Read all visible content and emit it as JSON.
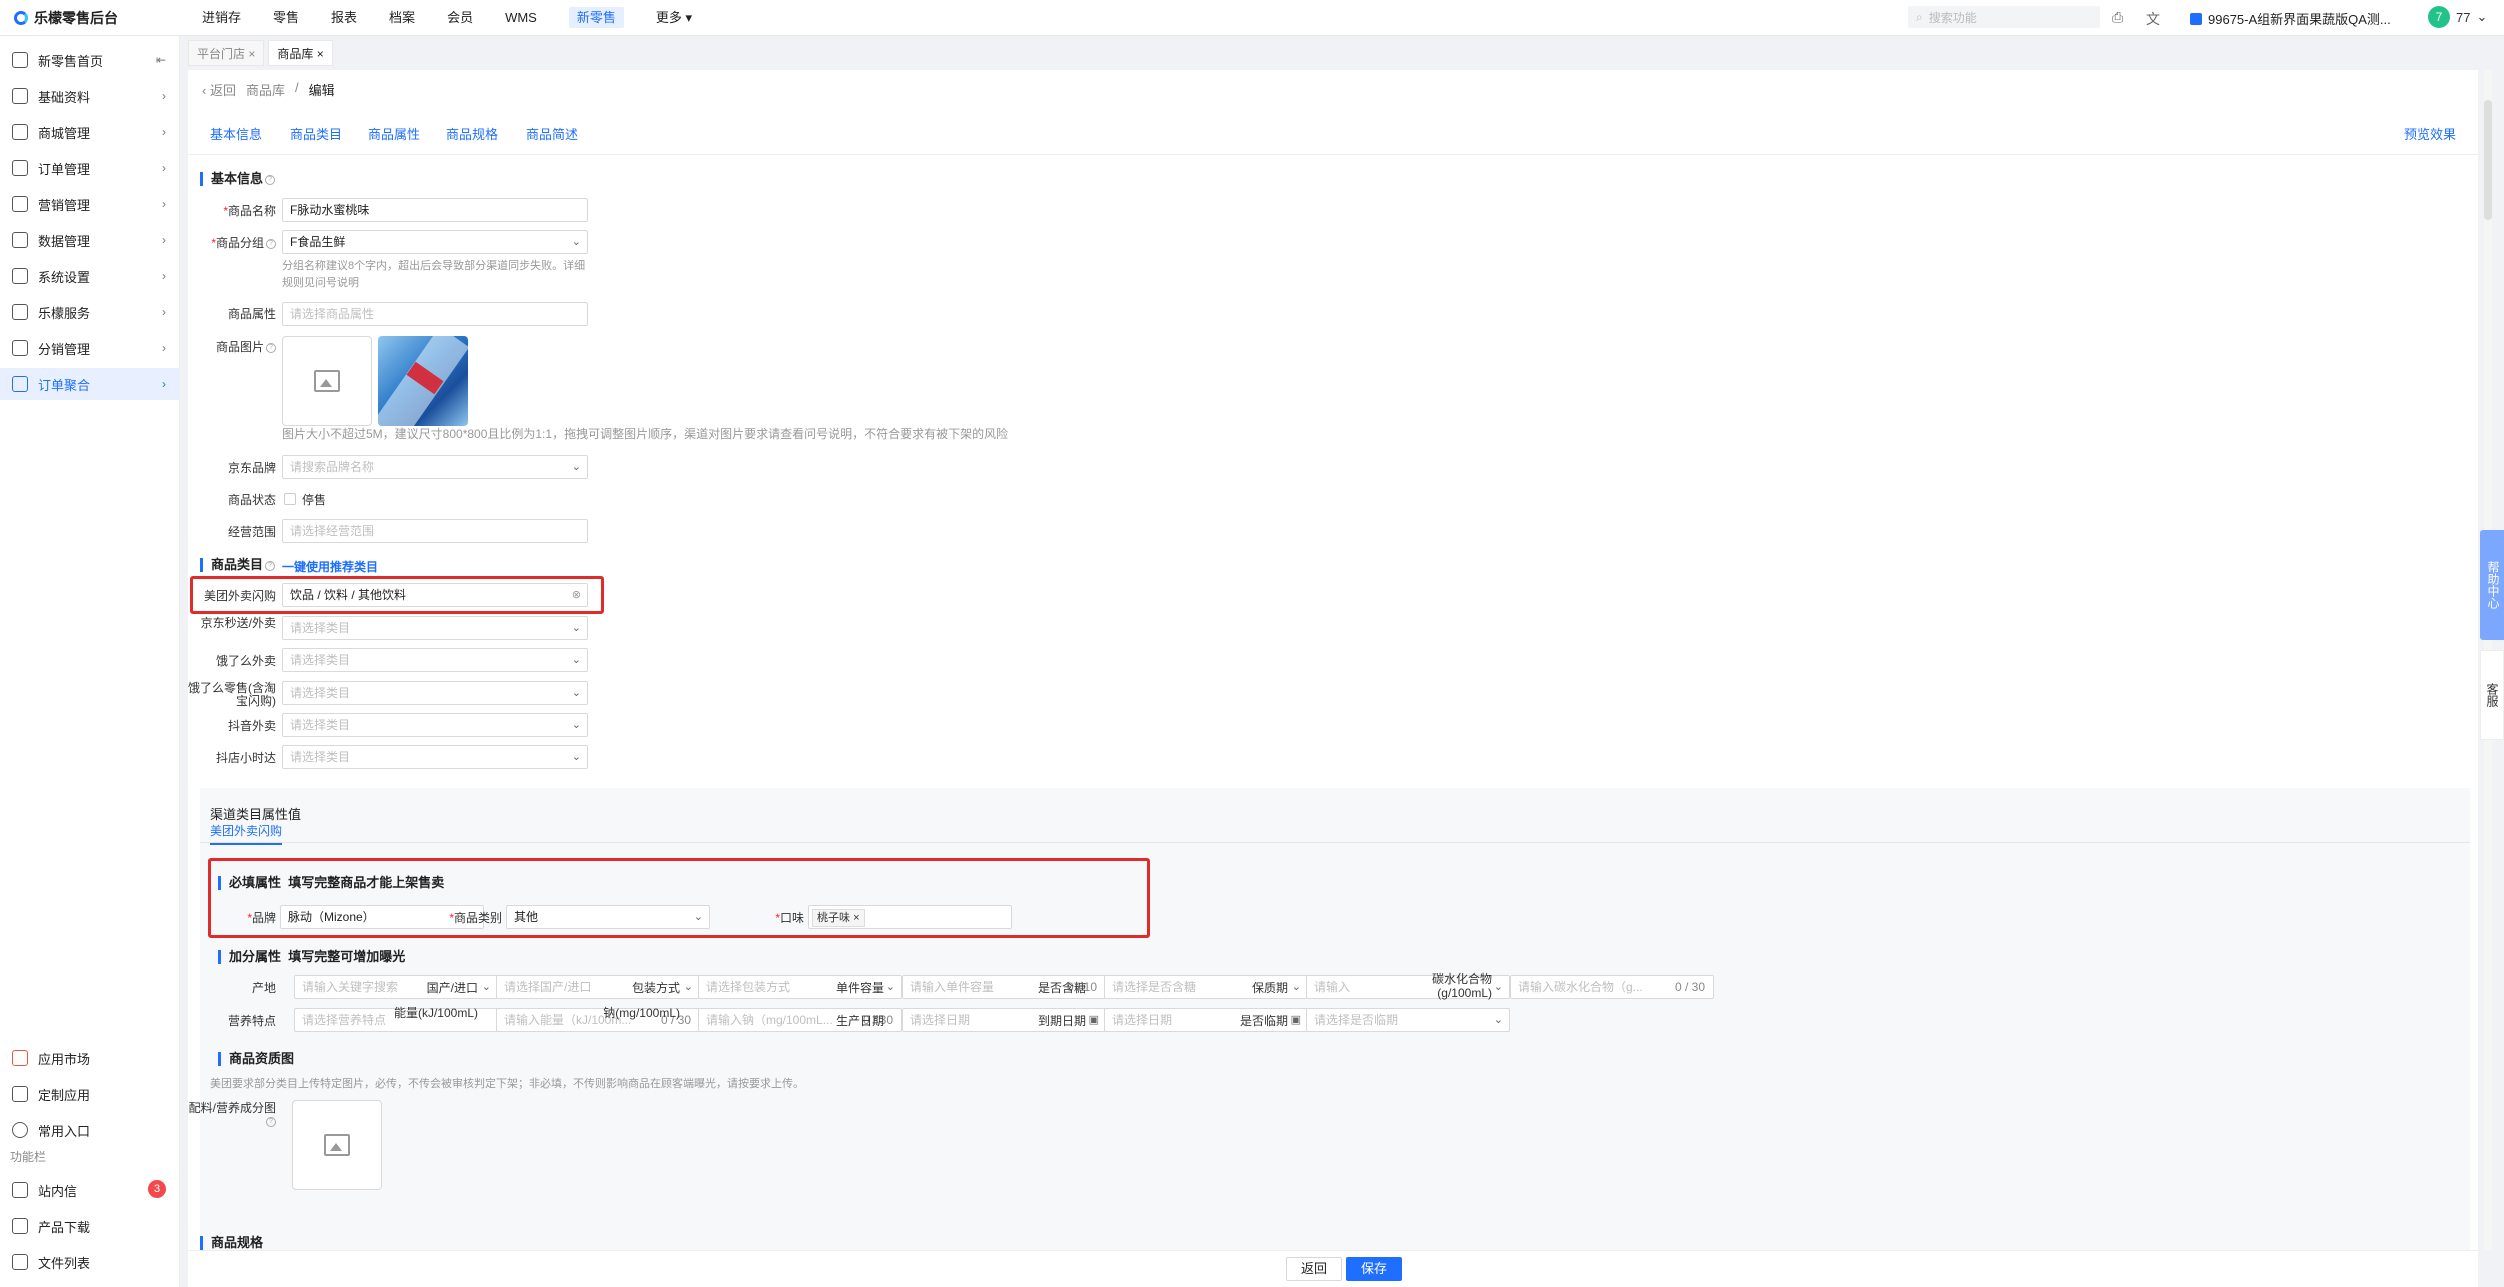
{
  "app": {
    "title": "乐檬零售后台"
  },
  "topnav": {
    "items": [
      "进销存",
      "零售",
      "报表",
      "档案",
      "会员",
      "WMS",
      "新零售"
    ],
    "more": "更多",
    "search_placeholder": "搜索功能",
    "store": "99675-A组新界面果蔬版QA测...",
    "user_avatar": "7",
    "user_name": "77"
  },
  "sidebar": {
    "items": [
      "新零售首页",
      "基础资料",
      "商城管理",
      "订单管理",
      "营销管理",
      "数据管理",
      "系统设置",
      "乐檬服务",
      "分销管理",
      "订单聚合"
    ],
    "bottom": [
      "应用市场",
      "定制应用",
      "常用入口"
    ],
    "section": "功能栏",
    "func": [
      "站内信",
      "产品下载",
      "文件列表"
    ],
    "badge": "3"
  },
  "page_tabs": [
    "平台门店",
    "商品库"
  ],
  "breadcrumb": {
    "back": "返回",
    "parent": "商品库",
    "sep": "/",
    "current": "编辑"
  },
  "anchors": [
    "基本信息",
    "商品类目",
    "商品属性",
    "商品规格",
    "商品简述"
  ],
  "preview": "预览效果",
  "basic": {
    "title": "基本信息",
    "name_label": "商品名称",
    "name_value": "F脉动水蜜桃味",
    "group_label": "商品分组",
    "group_value": "F食品生鲜",
    "group_hint_1": "分组名称建议8个字内，超出后会导致部分渠道同步失败。详细",
    "group_hint_2": "规则见问号说明",
    "attr_label": "商品属性",
    "attr_placeholder": "请选择商品属性",
    "image_label": "商品图片",
    "image_hint": "图片大小不超过5M，建议尺寸800*800且比例为1:1，拖拽可调整图片顺序，渠道对图片要求请查看问号说明，不符合要求有被下架的风险",
    "brand_label": "京东品牌",
    "brand_placeholder": "请搜索品牌名称",
    "status_label": "商品状态",
    "status_value": "停售",
    "scope_label": "经营范围",
    "scope_placeholder": "请选择经营范围"
  },
  "category": {
    "title": "商品类目",
    "recommend": "一键使用推荐类目",
    "rows": [
      {
        "label": "美团外卖闪购",
        "value": "饮品 / 饮料 / 其他饮料"
      },
      {
        "label": "京东秒送/外卖",
        "value": "请选择类目"
      },
      {
        "label": "饿了么外卖",
        "value": "请选择类目"
      },
      {
        "label": "饿了么零售(含淘宝闪购)",
        "value": "请选择类目"
      },
      {
        "label": "抖音外卖",
        "value": "请选择类目"
      },
      {
        "label": "抖店小时达",
        "value": "请选择类目"
      }
    ]
  },
  "channel_attr": {
    "title": "渠道类目属性值",
    "tab": "美团外卖闪购",
    "required_title": "必填属性",
    "required_sub": "填写完整商品才能上架售卖",
    "brand_label": "品牌",
    "brand_value": "脉动（Mizone）",
    "type_label": "商品类别",
    "type_value": "其他",
    "flavor_label": "口味",
    "flavor_tag": "桃子味",
    "bonus_title": "加分属性",
    "bonus_sub": "填写完整可增加曝光",
    "row1": [
      {
        "label": "产地",
        "ph": "请输入关键字搜索"
      },
      {
        "label": "国产/进口",
        "ph": "请选择国产/进口"
      },
      {
        "label": "包装方式",
        "ph": "请选择包装方式"
      },
      {
        "label": "单件容量",
        "ph": "请输入单件容量",
        "cnt": "0 / 10"
      },
      {
        "label": "是否含糖",
        "ph": "请选择是否含糖"
      },
      {
        "label": "保质期",
        "ph": "请输入"
      },
      {
        "label": "碳水化合物(g/100mL)",
        "ph": "请输入碳水化合物（g...",
        "cnt": "0 / 30"
      }
    ],
    "row2": [
      {
        "label": "营养特点",
        "ph": "请选择营养特点"
      },
      {
        "label": "能量(kJ/100mL)",
        "ph": "请输入能量（kJ/100m...",
        "cnt": "0 / 30"
      },
      {
        "label": "钠(mg/100mL)",
        "ph": "请输入钠（mg/100mL...",
        "cnt": "0 / 30"
      },
      {
        "label": "生产日期",
        "ph": "请选择日期"
      },
      {
        "label": "到期日期",
        "ph": "请选择日期"
      },
      {
        "label": "是否临期",
        "ph": "请选择是否临期"
      }
    ],
    "quality_title": "商品资质图",
    "quality_hint": "美团要求部分类目上传特定图片，必传，不传会被审核判定下架；非必填，不传则影响商品在顾客端曝光，请按要求上传。",
    "quality_label": "配料/营养成分图"
  },
  "spec": {
    "title": "商品规格"
  },
  "footer": {
    "back": "返回",
    "save": "保存"
  },
  "floats": {
    "help": "帮助中心",
    "cs": "客服"
  }
}
